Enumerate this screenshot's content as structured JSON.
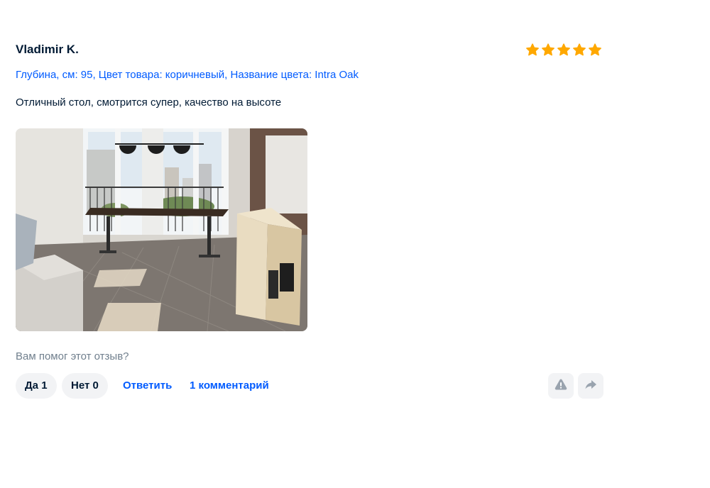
{
  "review": {
    "author": "Vladimir K.",
    "rating": 5,
    "rating_max": 5,
    "star_color": "#ffa800",
    "properties": "Глубина, см: 95, Цвет товара: коричневый, Название цвета: Intra Oak",
    "text": "Отличный стол, смотрится супер, качество на высоте",
    "photo": {
      "subject": "room-with-dining-table-and-tv-box-photo"
    }
  },
  "feedback": {
    "question": "Вам помог этот отзыв?",
    "yes_label": "Да 1",
    "no_label": "Нет 0",
    "reply_label": "Ответить",
    "comments_label": "1 комментарий",
    "report_icon": "warning-icon",
    "share_icon": "share-icon"
  },
  "colors": {
    "accent": "#005bff",
    "muted": "#707f8d",
    "pill_bg": "#f2f3f5",
    "icon_gray": "#99a3ae"
  }
}
